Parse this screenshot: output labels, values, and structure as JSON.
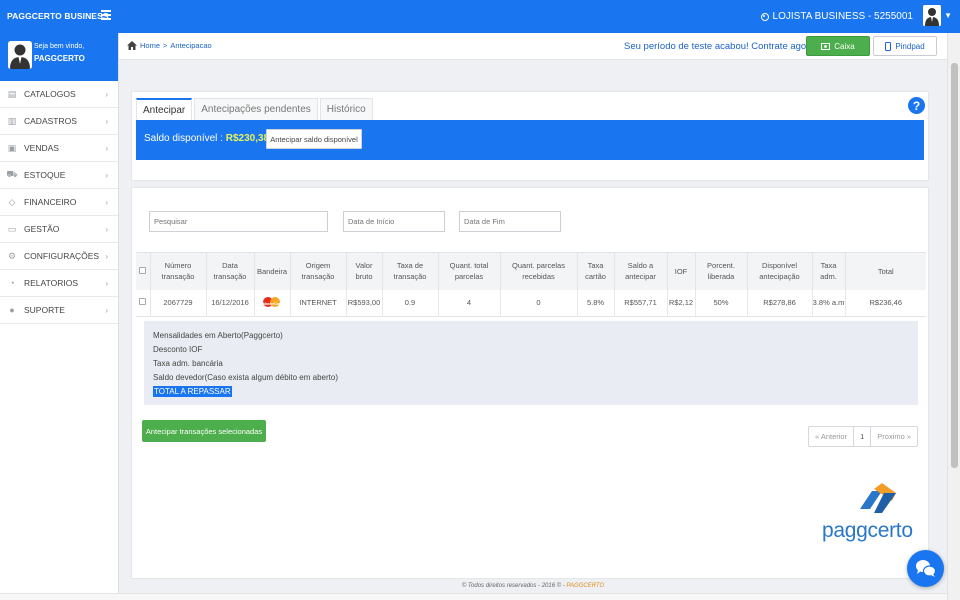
{
  "topbar": {
    "brand": "PAGGCERTO BUSINESS",
    "store": "LOJISTA BUSINESS - 5255001"
  },
  "sidebar": {
    "hello": "Seja bem vindo,",
    "user": "PAGGCERTO",
    "items": [
      {
        "label": "CATALOGOS",
        "icon": "catalog-icon"
      },
      {
        "label": "CADASTROS",
        "icon": "barcode-icon"
      },
      {
        "label": "VENDAS",
        "icon": "register-icon"
      },
      {
        "label": "ESTOQUE",
        "icon": "truck-icon"
      },
      {
        "label": "FINANCEIRO",
        "icon": "tag-icon"
      },
      {
        "label": "GESTÃO",
        "icon": "monitor-icon"
      },
      {
        "label": "CONFIGURAÇÕES",
        "icon": "gears-icon"
      },
      {
        "label": "RELATORIOS",
        "icon": "chart-icon"
      },
      {
        "label": "SUPORTE",
        "icon": "chat-icon"
      }
    ]
  },
  "breadcrumb": {
    "home": "Home",
    "sep": ">",
    "current": "Antecipacao"
  },
  "trial_message": "Seu período de teste acabou! Contrate agora!",
  "header_buttons": {
    "caixa": "Caixa",
    "pinpad": "Pindpad"
  },
  "tabs": [
    "Antecipar",
    "Antecipações pendentes",
    "Histórico"
  ],
  "help": "?",
  "saldo": {
    "label": "Saldo disponível :",
    "value": "R$230,38",
    "button": "Antecipar saldo disponível"
  },
  "filters": {
    "search": "Pesquisar",
    "start": "Data de Início",
    "end": "Data de Fim"
  },
  "table": {
    "headers": [
      "Número transação",
      "Data transação",
      "Bandeira",
      "Origem transação",
      "Valor bruto",
      "Taxa de transação",
      "Quant. total parcelas",
      "Quant. parcelas recebidas",
      "Taxa cartão",
      "Saldo a antecipar",
      "IOF",
      "Porcent. liberada",
      "Disponível antecipação",
      "Taxa adm.",
      "Total"
    ],
    "row": {
      "numero": "2067729",
      "data": "16/12/2016",
      "bandeira_text": "MasterCard",
      "origem": "INTERNET",
      "valor": "R$593,00",
      "taxa_transacao": "0.9",
      "total_parcelas": "4",
      "parcelas_recebidas": "0",
      "taxa_cartao": "5.8%",
      "saldo": "R$557,71",
      "iof": "R$2,12",
      "porcent": "50%",
      "disponivel": "R$278,86",
      "taxa_adm": "3.8% a.m",
      "total": "R$236,46"
    }
  },
  "details": {
    "mensalidades": "Mensalidades em Aberto(Paggcerto)",
    "iof": "Desconto IOF",
    "taxa_bancaria": "Taxa adm. bancária",
    "saldo_devedor": "Saldo devedor(Caso exista algum débito em aberto)",
    "total_repassar": "TOTAL A REPASSAR"
  },
  "actions": {
    "anticipate_selected": "Antecipar transações selecionadas"
  },
  "pager": {
    "prev": "« Anterior",
    "page": "1",
    "next": "Proximo »"
  },
  "logo_text": "paggcerto",
  "footer": {
    "text": "© Todos direitos reservados - 2016 © - ",
    "brand": "PAGGCERTO"
  },
  "colors": {
    "primary": "#1a75f0",
    "success": "#4cae4c",
    "saldo_value": "#e6f35a"
  }
}
